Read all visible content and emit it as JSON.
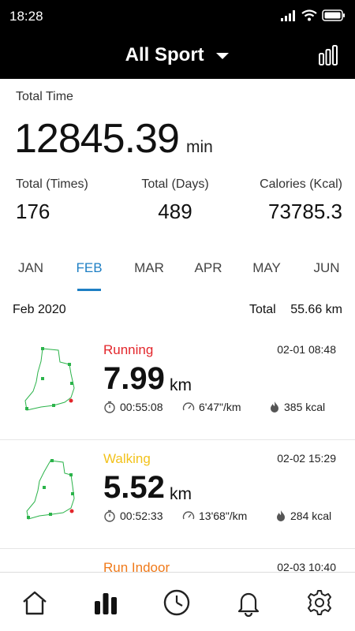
{
  "status": {
    "time": "18:28"
  },
  "header": {
    "title": "All Sport"
  },
  "summary": {
    "total_time_label": "Total Time",
    "total_time_value": "12845.39",
    "total_time_unit": "min",
    "stats": [
      {
        "label": "Total (Times)",
        "value": "176"
      },
      {
        "label": "Total (Days)",
        "value": "489"
      },
      {
        "label": "Calories (Kcal)",
        "value": "73785.3"
      }
    ]
  },
  "months": [
    "JAN",
    "FEB",
    "MAR",
    "APR",
    "MAY",
    "JUN"
  ],
  "active_month": "FEB",
  "period": {
    "label": "Feb 2020",
    "total_label": "Total",
    "total_value": "55.66 km"
  },
  "activities": [
    {
      "type": "Running",
      "color": "#e3262b",
      "datetime": "02-01  08:48",
      "distance": "7.99",
      "unit": "km",
      "duration": "00:55:08",
      "pace": "6'47\"/km",
      "calories": "385 kcal"
    },
    {
      "type": "Walking",
      "color": "#f2c21c",
      "datetime": "02-02  15:29",
      "distance": "5.52",
      "unit": "km",
      "duration": "00:52:33",
      "pace": "13'68\"/km",
      "calories": "284 kcal"
    },
    {
      "type": "Run Indoor",
      "color": "#f07a1a",
      "datetime": "02-03  10:40",
      "distance": "",
      "unit": "",
      "duration": "",
      "pace": "",
      "calories": ""
    }
  ],
  "colors": {
    "accent": "#1e7fc4",
    "header_bg": "#000000"
  },
  "tabbar": [
    "home-icon",
    "stats-icon",
    "clock-icon",
    "bell-icon",
    "settings-icon"
  ]
}
